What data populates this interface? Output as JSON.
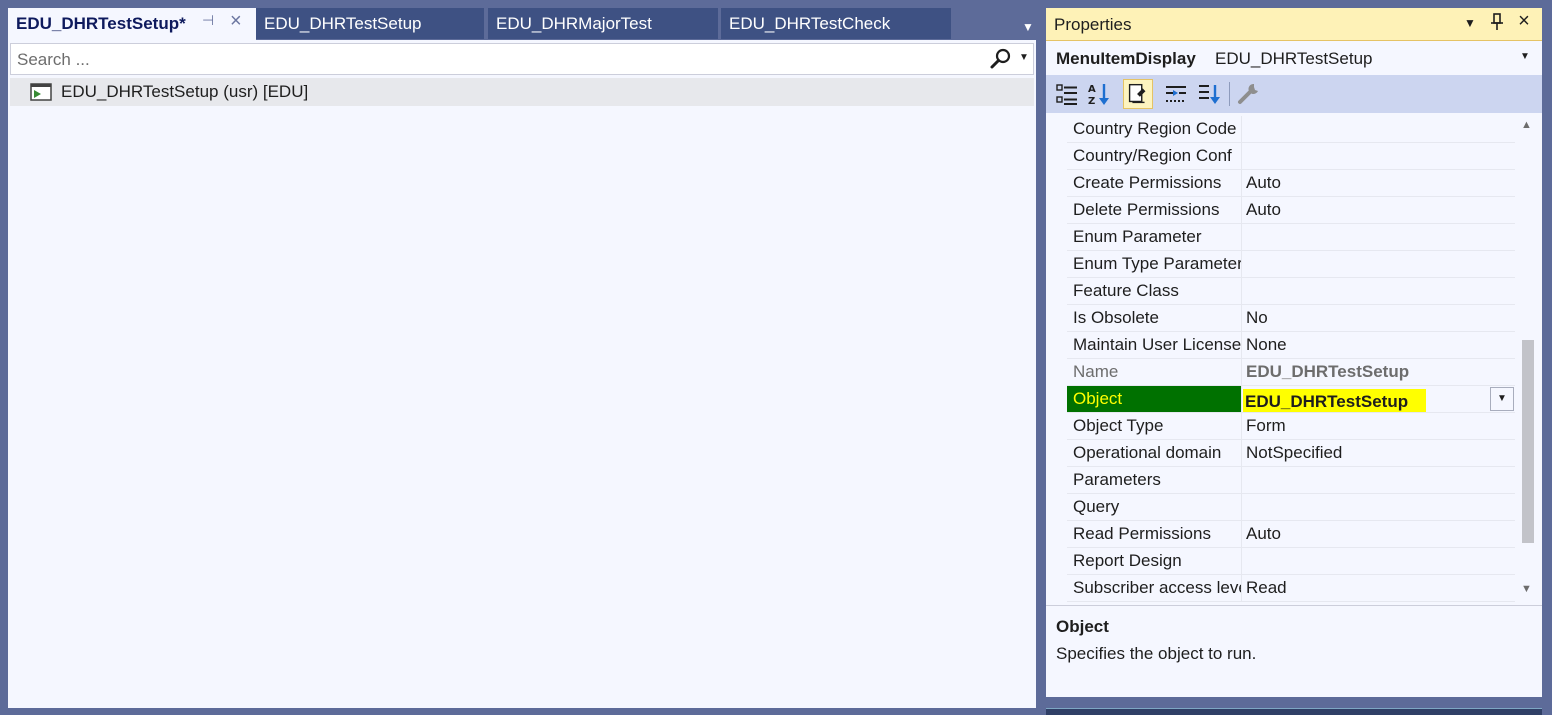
{
  "tabs": [
    {
      "label": "EDU_DHRTestSetup*",
      "active": true
    },
    {
      "label": "EDU_DHRTestSetup",
      "active": false
    },
    {
      "label": "EDU_DHRMajorTest",
      "active": false
    },
    {
      "label": "EDU_DHRTestCheck",
      "active": false
    }
  ],
  "search": {
    "placeholder": "Search ..."
  },
  "tree": {
    "items": [
      {
        "label": "EDU_DHRTestSetup (usr) [EDU]",
        "icon": "menu-item-display-icon"
      }
    ]
  },
  "properties": {
    "title": "Properties",
    "object_type": "MenuItemDisplay",
    "object_name": "EDU_DHRTestSetup",
    "rows": [
      {
        "name": "Country Region Code",
        "value": ""
      },
      {
        "name": "Country/Region Conf",
        "value": ""
      },
      {
        "name": "Create Permissions",
        "value": "Auto"
      },
      {
        "name": "Delete Permissions",
        "value": "Auto"
      },
      {
        "name": "Enum Parameter",
        "value": ""
      },
      {
        "name": "Enum Type Parameter",
        "value": ""
      },
      {
        "name": "Feature Class",
        "value": ""
      },
      {
        "name": "Is Obsolete",
        "value": "No"
      },
      {
        "name": "Maintain User License",
        "value": "None"
      },
      {
        "name": "Name",
        "value": "EDU_DHRTestSetup",
        "readonly": true
      },
      {
        "name": "Object",
        "value": "EDU_DHRTestSetup",
        "selected": true
      },
      {
        "name": "Object Type",
        "value": "Form"
      },
      {
        "name": "Operational domain",
        "value": "NotSpecified"
      },
      {
        "name": "Parameters",
        "value": ""
      },
      {
        "name": "Query",
        "value": ""
      },
      {
        "name": "Read Permissions",
        "value": "Auto"
      },
      {
        "name": "Report Design",
        "value": ""
      },
      {
        "name": "Subscriber access level",
        "value": "Read"
      }
    ],
    "description": {
      "title": "Object",
      "text": "Specifies the object to run."
    }
  },
  "colors": {
    "accent_tab": "#3e5183",
    "title_highlight": "#fef2b7",
    "selected_name_bg": "#007100",
    "selected_value_bg": "#ffff00"
  }
}
